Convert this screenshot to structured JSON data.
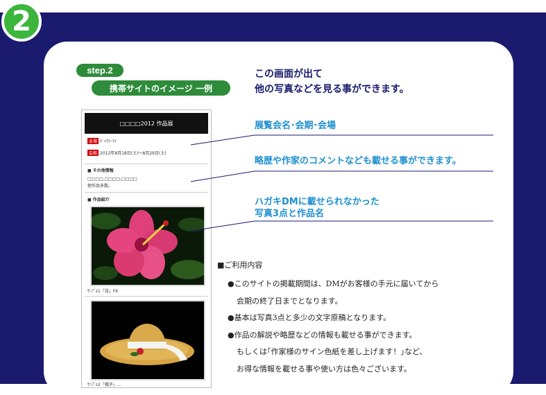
{
  "step_number": "2",
  "step_pill": "step.2",
  "step_subtitle": "携帯サイトのイメージ 一例",
  "headline": [
    "この画面が出て",
    "他の写真などを見る事ができます。"
  ],
  "phone": {
    "header": "□□□□2012 作品展",
    "tag_venue": "会場",
    "venue_text": "ｷﾞｬﾗﾘｰｱｲ",
    "tag_period": "会期",
    "period_text": "2012年8月18日(土)〜8月29日(土)",
    "other_heading": "■ その他情報",
    "other_line1": "□□□□,□□□□,□□□□",
    "other_line2": "他作品多数。",
    "works_heading": "■ 作品紹介",
    "caption1": "ｻﾝﾌﾟﾙ1「花」F6",
    "caption2": "ｻﾝﾌﾟﾙ2「帽子」..."
  },
  "callouts": {
    "c1": "展覧会名･会期･会場",
    "c2": "略歴や作家のコメントなども載せる事ができます。",
    "c3a": "ハガキDMに載せられなかった",
    "c3b": "写真3点と作品名"
  },
  "usage": {
    "title": "■ご利用内容",
    "items": [
      "●このサイトの掲載期間は、DMがお客様の手元に届いてから",
      "会期の終了日までとなります。",
      "●基本は写真3点と多少の文字原稿となります。",
      "●作品の解説や略歴などの情報も載せる事ができます。",
      "もしくは｢作家様のサイン色紙を差し上げます！｣など、",
      "お得な情報を載せる事や使い方は色々ございます。"
    ]
  },
  "colors": {
    "navy": "#1a1a6e",
    "green": "#3cb53c",
    "callout_blue": "#1e90d0"
  }
}
